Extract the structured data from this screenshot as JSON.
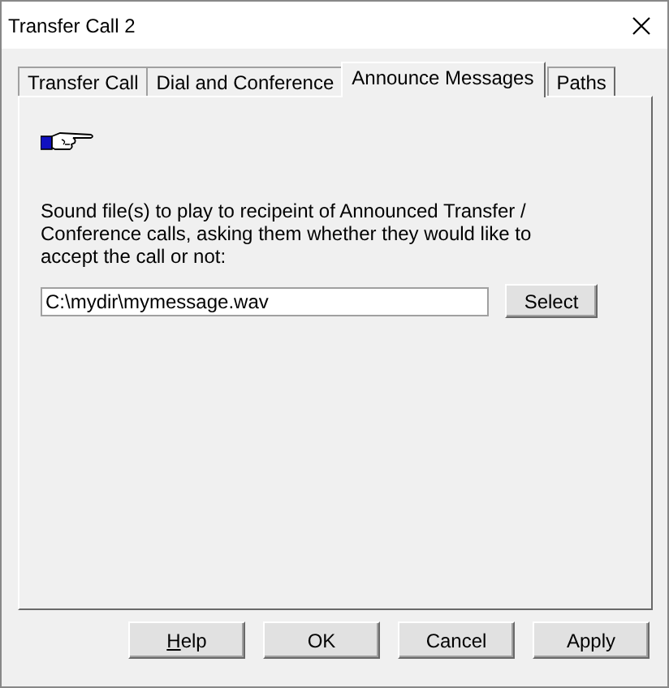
{
  "window": {
    "title": "Transfer Call 2"
  },
  "tabs": [
    {
      "label": "Transfer Call",
      "selected": false
    },
    {
      "label": "Dial and Conference",
      "selected": false
    },
    {
      "label": "Announce Messages",
      "selected": true
    },
    {
      "label": "Paths",
      "selected": false
    }
  ],
  "description": "Sound file(s) to play to recipeint of Announced Transfer / Conference calls, asking them whether they would like to accept the call or not:",
  "file_field": {
    "value": "C:\\mydir\\mymessage.wav"
  },
  "select_button": "Select",
  "buttons": [
    {
      "label": "Help",
      "mnemonic_first": true
    },
    {
      "label": "OK",
      "mnemonic_first": false
    },
    {
      "label": "Cancel",
      "mnemonic_first": false
    },
    {
      "label": "Apply",
      "mnemonic_first": false
    }
  ]
}
